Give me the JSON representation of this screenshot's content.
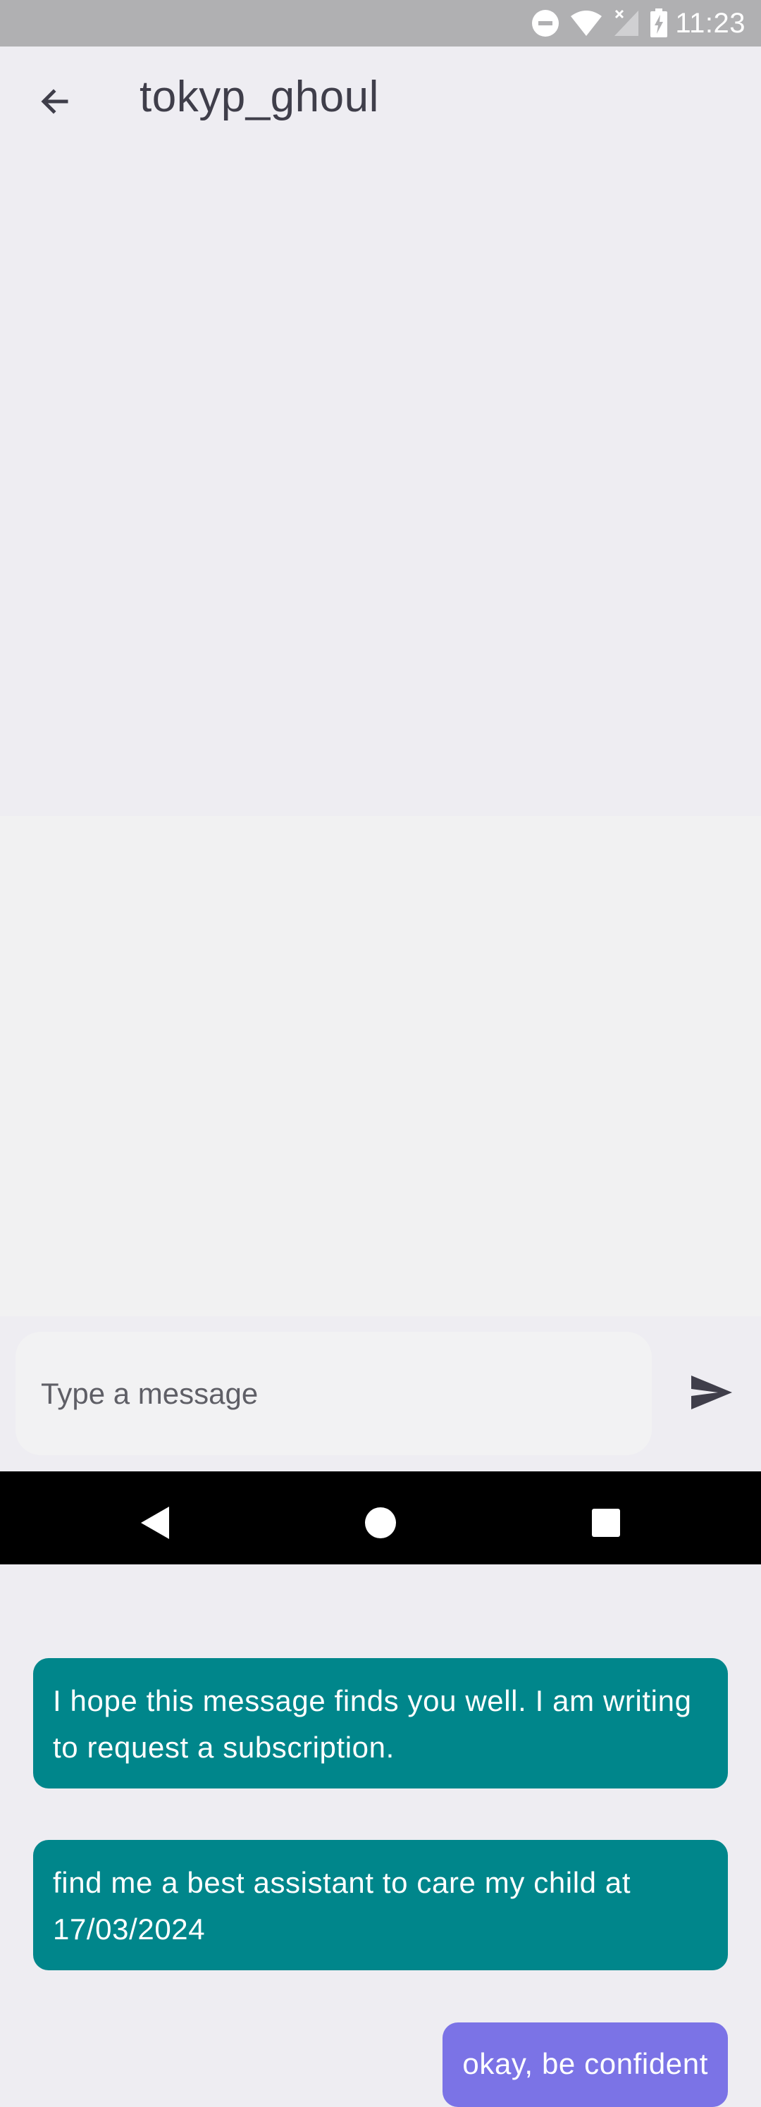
{
  "status_bar": {
    "time": "11:23",
    "icons": [
      "do-not-disturb-icon",
      "wifi-icon",
      "no-signal-icon",
      "battery-charging-icon"
    ]
  },
  "header": {
    "back_icon": "arrow-left-icon",
    "title": "tokyp_ghoul"
  },
  "messages": [
    {
      "direction": "incoming",
      "text": "I hope this message finds you well. I am writing to request a subscription."
    },
    {
      "direction": "incoming",
      "text": "find me a best assistant to care my child at 17/03/2024"
    },
    {
      "direction": "outgoing",
      "text": "okay, be confident"
    }
  ],
  "composer": {
    "placeholder": "Type a message",
    "value": "",
    "send_icon": "send-icon"
  },
  "nav_bar": {
    "icons": [
      "nav-back-icon",
      "nav-home-icon",
      "nav-recents-icon"
    ]
  },
  "colors": {
    "incoming_bubble": "#00868b",
    "outgoing_bubble": "#7b73e6",
    "background": "#eeedf2"
  }
}
